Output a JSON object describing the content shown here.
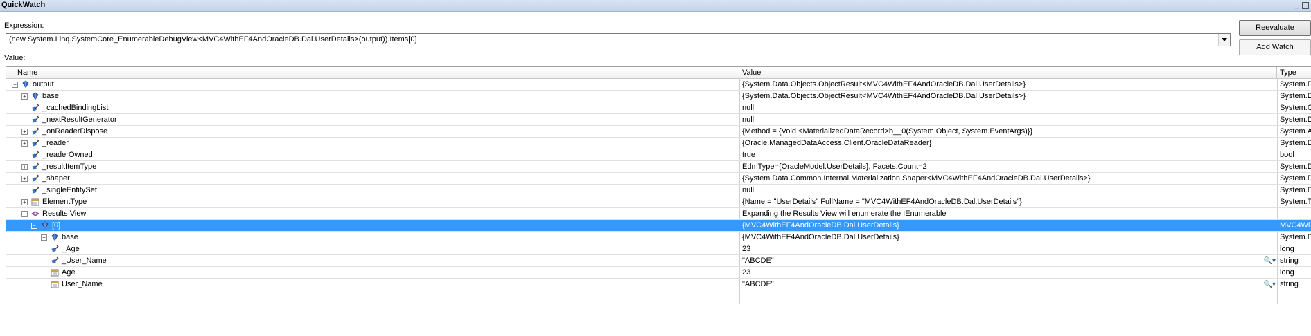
{
  "window": {
    "title": "QuickWatch",
    "min_icon": "minimize-icon",
    "restore_icon": "restore-icon"
  },
  "expression": {
    "label": "Expression:",
    "value": "(new System.Linq.SystemCore_EnumerableDebugView<MVC4WithEF4AndOracleDB.Dal.UserDetails>(output)).Items[0]"
  },
  "buttons": {
    "reevaluate": "Reevaluate",
    "add_watch": "Add Watch"
  },
  "value_label": "Value:",
  "grid": {
    "columns": [
      "Name",
      "Value",
      "Type"
    ],
    "rows": [
      {
        "name": "output",
        "value": "{System.Data.Objects.ObjectResult<MVC4WithEF4AndOracleDB.Dal.UserDetails>}",
        "type": "System.D",
        "indent": 0,
        "expander": "minus",
        "icon": "object-icon"
      },
      {
        "name": "base",
        "value": "{System.Data.Objects.ObjectResult<MVC4WithEF4AndOracleDB.Dal.UserDetails>}",
        "type": "System.D",
        "indent": 1,
        "expander": "plus",
        "icon": "object-icon"
      },
      {
        "name": "_cachedBindingList",
        "value": "null",
        "type": "System.C",
        "indent": 1,
        "expander": "none",
        "icon": "field-icon"
      },
      {
        "name": "_nextResultGenerator",
        "value": "null",
        "type": "System.D",
        "indent": 1,
        "expander": "none",
        "icon": "field-icon"
      },
      {
        "name": "_onReaderDispose",
        "value": "{Method = {Void <MaterializedDataRecord>b__0(System.Object, System.EventArgs)}}",
        "type": "System.A",
        "indent": 1,
        "expander": "plus",
        "icon": "field-icon"
      },
      {
        "name": "_reader",
        "value": "{Oracle.ManagedDataAccess.Client.OracleDataReader}",
        "type": "System.D",
        "indent": 1,
        "expander": "plus",
        "icon": "field-icon"
      },
      {
        "name": "_readerOwned",
        "value": "true",
        "type": "bool",
        "indent": 1,
        "expander": "none",
        "icon": "field-icon"
      },
      {
        "name": "_resultItemType",
        "value": "EdmType={OracleModel.UserDetails}, Facets.Count=2",
        "type": "System.D",
        "indent": 1,
        "expander": "plus",
        "icon": "field-icon"
      },
      {
        "name": "_shaper",
        "value": "{System.Data.Common.Internal.Materialization.Shaper<MVC4WithEF4AndOracleDB.Dal.UserDetails>}",
        "type": "System.D",
        "indent": 1,
        "expander": "plus",
        "icon": "field-icon"
      },
      {
        "name": "_singleEntitySet",
        "value": "null",
        "type": "System.D",
        "indent": 1,
        "expander": "none",
        "icon": "field-icon"
      },
      {
        "name": "ElementType",
        "value": "{Name = \"UserDetails\" FullName = \"MVC4WithEF4AndOracleDB.Dal.UserDetails\"}",
        "type": "System.T",
        "indent": 1,
        "expander": "plus",
        "icon": "property-icon"
      },
      {
        "name": "Results View",
        "value": "Expanding the Results View will enumerate the IEnumerable",
        "type": "",
        "indent": 1,
        "expander": "minus",
        "icon": "results-view-icon"
      },
      {
        "name": "[0]",
        "value": "{MVC4WithEF4AndOracleDB.Dal.UserDetails}",
        "type": "MVC4Wi",
        "indent": 2,
        "expander": "minus",
        "icon": "object-icon",
        "selected": true
      },
      {
        "name": "base",
        "value": "{MVC4WithEF4AndOracleDB.Dal.UserDetails}",
        "type": "System.D",
        "indent": 3,
        "expander": "plus",
        "icon": "object-icon"
      },
      {
        "name": "_Age",
        "value": "23",
        "type": "long",
        "indent": 3,
        "expander": "none",
        "icon": "field-icon"
      },
      {
        "name": "_User_Name",
        "value": "\"ABCDE\"",
        "type": "string",
        "indent": 3,
        "expander": "none",
        "icon": "field-icon",
        "visualizer": "magnifier-icon"
      },
      {
        "name": "Age",
        "value": "23",
        "type": "long",
        "indent": 3,
        "expander": "none",
        "icon": "property-icon"
      },
      {
        "name": "User_Name",
        "value": "\"ABCDE\"",
        "type": "string",
        "indent": 3,
        "expander": "none",
        "icon": "property-icon",
        "visualizer": "magnifier-icon"
      }
    ]
  }
}
